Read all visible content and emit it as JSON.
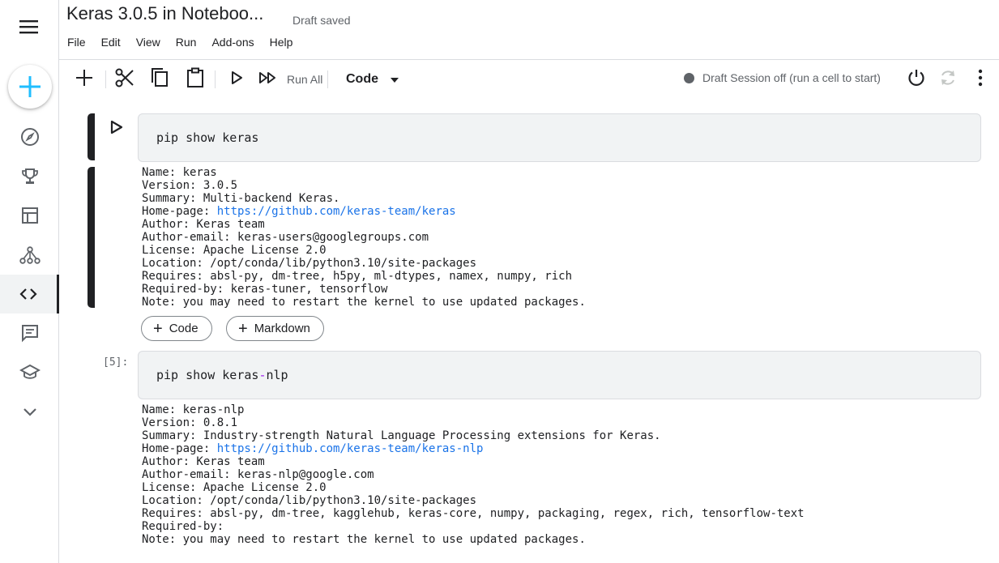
{
  "header": {
    "title": "Keras 3.0.5 in Noteboo...",
    "draft_status": "Draft saved",
    "menu": [
      "File",
      "Edit",
      "View",
      "Run",
      "Add-ons",
      "Help"
    ]
  },
  "toolbar": {
    "run_all_label": "Run All",
    "cell_type": "Code",
    "session_status": "Draft Session off (run a cell to start)"
  },
  "sidebar": {
    "items": [
      "menu-icon",
      "create-icon",
      "compass-icon",
      "trophy-icon",
      "table-icon",
      "models-icon",
      "code-icon",
      "discussion-icon",
      "school-icon",
      "expand-more-icon"
    ]
  },
  "cells": [
    {
      "code": "pip show keras",
      "output": {
        "name": "Name: keras",
        "version": "Version: 3.0.5",
        "summary": "Summary: Multi-backend Keras.",
        "homepage_label": "Home-page: ",
        "homepage_url": "https://github.com/keras-team/keras",
        "author": "Author: Keras team",
        "author_email": "Author-email: keras-users@googlegroups.com",
        "license": "License: Apache License 2.0",
        "location": "Location: /opt/conda/lib/python3.10/site-packages",
        "requires": "Requires: absl-py, dm-tree, h5py, ml-dtypes, namex, numpy, rich",
        "required_by": "Required-by: keras-tuner, tensorflow",
        "note": "Note: you may need to restart the kernel to use updated packages."
      }
    },
    {
      "exec_count": "[5]:",
      "code_part1": "pip show keras",
      "code_op": "-",
      "code_part2": "nlp",
      "output": {
        "name": "Name: keras-nlp",
        "version": "Version: 0.8.1",
        "summary": "Summary: Industry-strength Natural Language Processing extensions for Keras.",
        "homepage_label": "Home-page: ",
        "homepage_url": "https://github.com/keras-team/keras-nlp",
        "author": "Author: Keras team",
        "author_email": "Author-email: keras-nlp@google.com",
        "license": "License: Apache License 2.0",
        "location": "Location: /opt/conda/lib/python3.10/site-packages",
        "requires": "Requires: absl-py, dm-tree, kagglehub, keras-core, numpy, packaging, regex, rich, tensorflow-text",
        "required_by": "Required-by:",
        "note": "Note: you may need to restart the kernel to use updated packages."
      }
    }
  ],
  "add_cell": {
    "code_label": "Code",
    "markdown_label": "Markdown"
  },
  "colors": {
    "accent": "#20beff",
    "link": "#1a73e8",
    "text": "#202124",
    "muted": "#5f6368"
  }
}
